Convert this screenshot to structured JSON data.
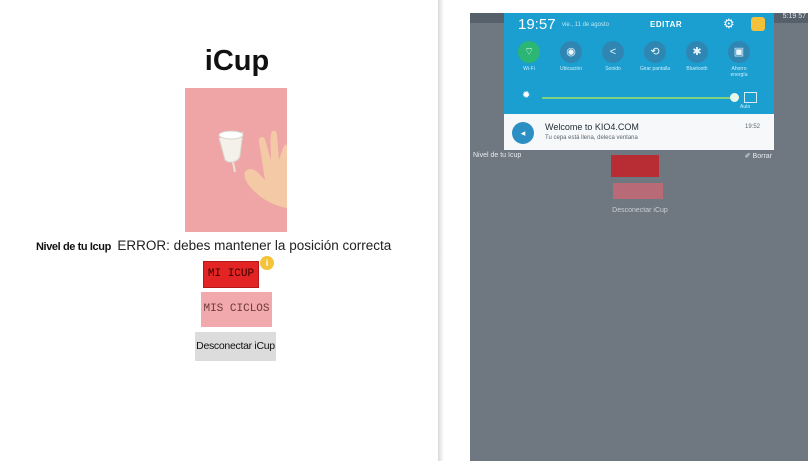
{
  "left_app": {
    "title": "iCup",
    "level_label": "Nivel de tu Icup",
    "level_value": "ERROR: debes mantener la posición correcta",
    "buttons": {
      "mi_icup": "MI ICUP",
      "mis_ciclos": "MIS CICLOS",
      "desconectar": "Desconectar iCup"
    },
    "notification_badge": "i",
    "colors": {
      "image_bg": "#efa4a6",
      "mi_icup_bg": "#e32424",
      "mis_ciclos_bg": "#f2a9ad",
      "desconectar_bg": "#dcdcdc"
    }
  },
  "tablet": {
    "status_right": "5:19 57",
    "quick_settings": {
      "time": "19:57",
      "date": "vie., 11 de agosto",
      "edit_label": "EDITAR",
      "tiles": [
        {
          "icon": "wifi-icon",
          "glyph": "⌔",
          "label": "Wi-Fi",
          "active": true
        },
        {
          "icon": "location-icon",
          "glyph": "◉",
          "label": "Ubicación",
          "active": false
        },
        {
          "icon": "share-icon",
          "glyph": "<",
          "label": "Sonido",
          "active": false
        },
        {
          "icon": "rotate-icon",
          "glyph": "⟲",
          "label": "Girar pantalla",
          "active": false
        },
        {
          "icon": "bluetooth-icon",
          "glyph": "✱",
          "label": "Bluetooth",
          "active": false
        },
        {
          "icon": "power-saving-icon",
          "glyph": "▣",
          "label": "Ahorro energía",
          "active": false
        }
      ],
      "brightness_icon": "✹",
      "auto_label": "Auto",
      "colors": {
        "panel": "#1a9fd0",
        "slider": "#7fd07f"
      }
    },
    "notification": {
      "title": "Welcome to KIO4.COM",
      "text": "Tu cepa está llena, deleca ventana",
      "time": "19:52",
      "icon_glyph": "◂"
    },
    "background_app": {
      "left_text": "Nivel de tu Icup",
      "right_text": "✐ Borrar",
      "gray_text": "Desconectar iCup"
    }
  }
}
